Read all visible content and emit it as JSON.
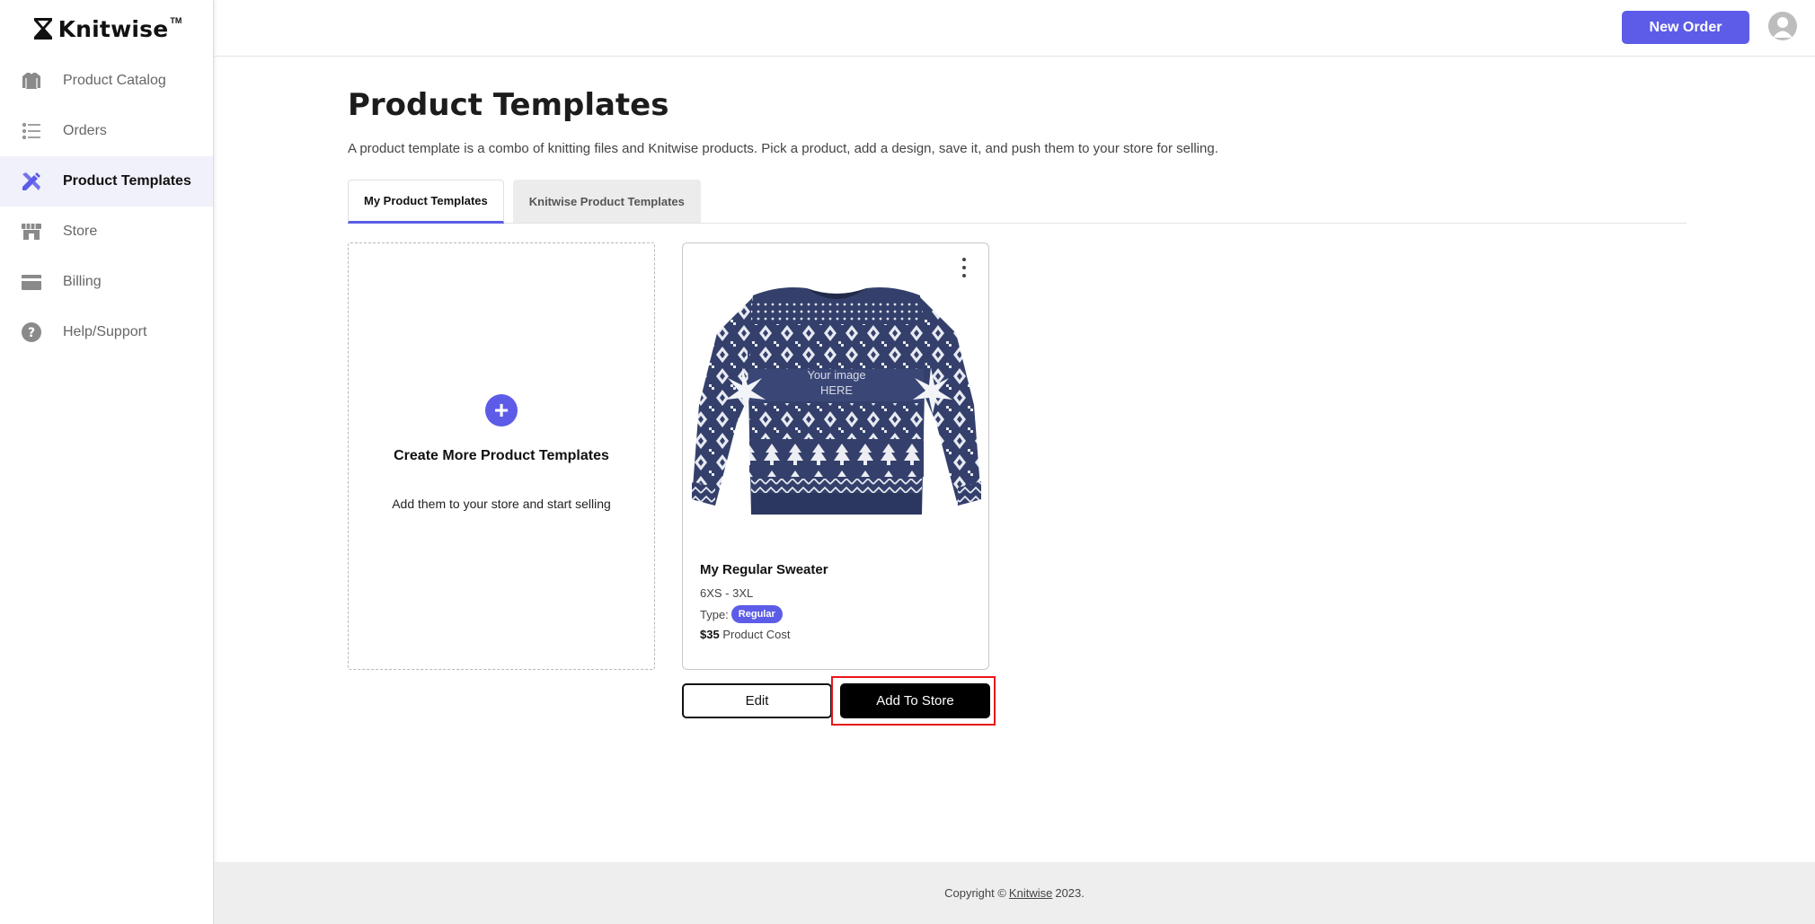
{
  "brand": {
    "name": "Knitwise",
    "tm": "TM"
  },
  "sidebar": {
    "items": [
      {
        "label": "Product Catalog",
        "icon": "sweater-icon",
        "active": false
      },
      {
        "label": "Orders",
        "icon": "list-icon",
        "active": false
      },
      {
        "label": "Product Templates",
        "icon": "pencil-ruler-icon",
        "active": true
      },
      {
        "label": "Store",
        "icon": "storefront-icon",
        "active": false
      },
      {
        "label": "Billing",
        "icon": "card-icon",
        "active": false
      },
      {
        "label": "Help/Support",
        "icon": "question-icon",
        "active": false
      }
    ]
  },
  "topbar": {
    "new_order_label": "New Order",
    "avatar_icon": "user-icon"
  },
  "page": {
    "title": "Product Templates",
    "description": "A product template is a combo of knitting files and Knitwise products. Pick a product, add a design, save it, and push them to your store for selling."
  },
  "tabs": [
    {
      "label": "My Product Templates",
      "active": true
    },
    {
      "label": "Knitwise Product Templates",
      "active": false
    }
  ],
  "create_card": {
    "title": "Create More Product Templates",
    "subtitle": "Add them to your store and start selling"
  },
  "product": {
    "name": "My Regular Sweater",
    "sizes": "6XS - 3XL",
    "type_label": "Type:",
    "type_value": "Regular",
    "cost_value": "$35",
    "cost_label": "Product Cost",
    "image_text_line1": "Your image",
    "image_text_line2": "HERE",
    "edit_label": "Edit",
    "add_label": "Add To Store"
  },
  "footer": {
    "prefix": "Copyright ©",
    "link": "Knitwise",
    "suffix": "2023."
  },
  "colors": {
    "accent": "#5c5ce8",
    "highlight": "#e8141b",
    "sweater": "#34406b"
  }
}
